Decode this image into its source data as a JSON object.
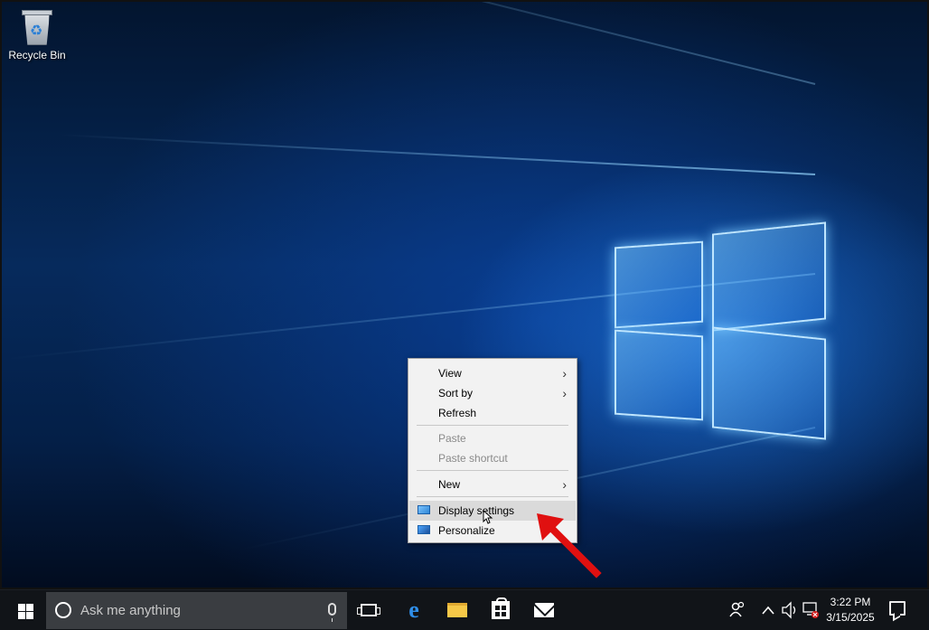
{
  "desktop": {
    "icons": [
      {
        "label": "Recycle Bin",
        "icon": "recycle-bin-icon"
      }
    ]
  },
  "context_menu": {
    "items": [
      {
        "label": "View",
        "submenu": true,
        "enabled": true
      },
      {
        "label": "Sort by",
        "submenu": true,
        "enabled": true
      },
      {
        "label": "Refresh",
        "submenu": false,
        "enabled": true
      },
      {
        "label": "Paste",
        "submenu": false,
        "enabled": false
      },
      {
        "label": "Paste shortcut",
        "submenu": false,
        "enabled": false
      },
      {
        "label": "New",
        "submenu": true,
        "enabled": true
      },
      {
        "label": "Display settings",
        "submenu": false,
        "enabled": true,
        "highlighted": true,
        "icon": "display-icon"
      },
      {
        "label": "Personalize",
        "submenu": false,
        "enabled": true,
        "icon": "personalize-icon"
      }
    ],
    "submenu_arrow": "›"
  },
  "taskbar": {
    "search_placeholder": "Ask me anything",
    "pinned": [
      "task-view-icon",
      "edge-icon",
      "file-explorer-icon",
      "store-icon",
      "mail-icon"
    ],
    "tray": {
      "icons": [
        "people-icon",
        "chevron-up-icon",
        "volume-icon",
        "network-icon"
      ],
      "time": "3:22 PM",
      "date": "3/15/2025"
    }
  },
  "colors": {
    "accent": "#0a64c8",
    "annotation_arrow": "#e01010"
  }
}
